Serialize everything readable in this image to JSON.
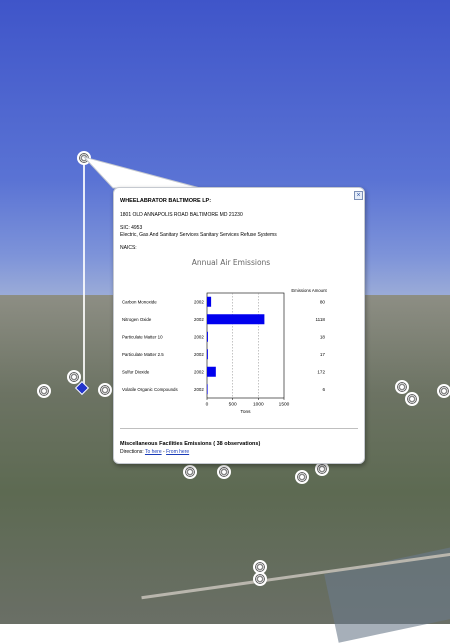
{
  "facility": {
    "name": "WHEELABRATOR BALTIMORE LP:",
    "address": "1801 OLD ANNAPOLIS ROAD BALTIMORE MD 21230",
    "sic": "SIC: 4953",
    "sic_description": "Electric, Gas And Sanitary Services Sanitary Services Refuse Systems",
    "naics": "NAICS:"
  },
  "chart_data": {
    "type": "bar",
    "title": "Annual Air Emissions",
    "amount_header": "Emissions Amount",
    "xlabel": "Tons",
    "xlim": [
      0,
      1500
    ],
    "xticks": [
      0,
      500,
      1000,
      1500
    ],
    "grid": true,
    "categories": [
      "Carbon Monoxide",
      "Nitrogen Oxide",
      "Particulate Matter 10",
      "Particulate Matter 2.5",
      "Sulfur Dioxide",
      "Volatile Organic Compounds"
    ],
    "years": [
      "2002",
      "2002",
      "2002",
      "2002",
      "2002",
      "2002"
    ],
    "values": [
      80,
      1118,
      18,
      17,
      172,
      6
    ],
    "bar_color": "#0000ee"
  },
  "footer": {
    "misc_emissions": "Miscellaneous Facilities Emissions ( 38 observations)",
    "directions_label": "Directions:",
    "to_here": "To here",
    "separator": "-",
    "from_here": "From here"
  },
  "close_glyph": "×",
  "icons": [
    "close-icon",
    "placemark-icon",
    "location-pin-icon"
  ]
}
